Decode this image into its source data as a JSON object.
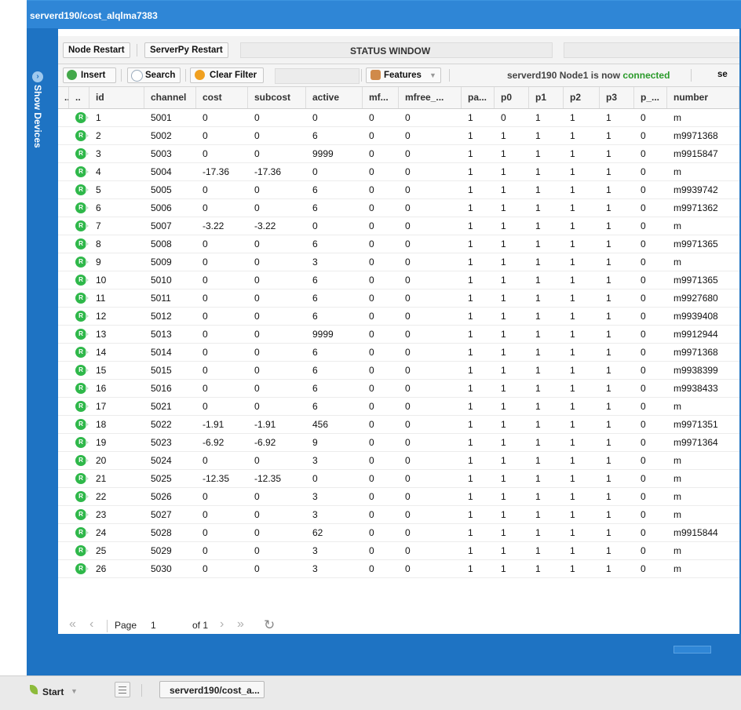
{
  "window": {
    "title": "serverd190/cost_alqlma7383"
  },
  "sidebar": {
    "label": "Show Devices"
  },
  "toolbar1": {
    "node_restart": "Node Restart",
    "serverpy_restart": "ServerPy Restart",
    "status_title": "STATUS WINDOW"
  },
  "toolbar2": {
    "insert": "Insert",
    "search": "Search",
    "clear_filter": "Clear Filter",
    "features": "Features",
    "status_prefix": "serverd190 Node1 is now",
    "status_state": "connected",
    "status_trailing": "se"
  },
  "columns": [
    "..",
    "..",
    "id",
    "channel",
    "cost",
    "subcost",
    "active",
    "mf...",
    "mfree_...",
    "pa...",
    "p0",
    "p1",
    "p2",
    "p3",
    "p_...",
    "number"
  ],
  "rows": [
    [
      "1",
      "5001",
      "0",
      "0",
      "0",
      "0",
      "0",
      "1",
      "0",
      "1",
      "1",
      "1",
      "0",
      "m"
    ],
    [
      "2",
      "5002",
      "0",
      "0",
      "6",
      "0",
      "0",
      "1",
      "1",
      "1",
      "1",
      "1",
      "0",
      "m9971368"
    ],
    [
      "3",
      "5003",
      "0",
      "0",
      "9999",
      "0",
      "0",
      "1",
      "1",
      "1",
      "1",
      "1",
      "0",
      "m9915847"
    ],
    [
      "4",
      "5004",
      "-17.36",
      "-17.36",
      "0",
      "0",
      "0",
      "1",
      "1",
      "1",
      "1",
      "1",
      "0",
      "m"
    ],
    [
      "5",
      "5005",
      "0",
      "0",
      "6",
      "0",
      "0",
      "1",
      "1",
      "1",
      "1",
      "1",
      "0",
      "m9939742"
    ],
    [
      "6",
      "5006",
      "0",
      "0",
      "6",
      "0",
      "0",
      "1",
      "1",
      "1",
      "1",
      "1",
      "0",
      "m9971362"
    ],
    [
      "7",
      "5007",
      "-3.22",
      "-3.22",
      "0",
      "0",
      "0",
      "1",
      "1",
      "1",
      "1",
      "1",
      "0",
      "m"
    ],
    [
      "8",
      "5008",
      "0",
      "0",
      "6",
      "0",
      "0",
      "1",
      "1",
      "1",
      "1",
      "1",
      "0",
      "m9971365"
    ],
    [
      "9",
      "5009",
      "0",
      "0",
      "3",
      "0",
      "0",
      "1",
      "1",
      "1",
      "1",
      "1",
      "0",
      "m"
    ],
    [
      "10",
      "5010",
      "0",
      "0",
      "6",
      "0",
      "0",
      "1",
      "1",
      "1",
      "1",
      "1",
      "0",
      "m9971365"
    ],
    [
      "11",
      "5011",
      "0",
      "0",
      "6",
      "0",
      "0",
      "1",
      "1",
      "1",
      "1",
      "1",
      "0",
      "m9927680"
    ],
    [
      "12",
      "5012",
      "0",
      "0",
      "6",
      "0",
      "0",
      "1",
      "1",
      "1",
      "1",
      "1",
      "0",
      "m9939408"
    ],
    [
      "13",
      "5013",
      "0",
      "0",
      "9999",
      "0",
      "0",
      "1",
      "1",
      "1",
      "1",
      "1",
      "0",
      "m9912944"
    ],
    [
      "14",
      "5014",
      "0",
      "0",
      "6",
      "0",
      "0",
      "1",
      "1",
      "1",
      "1",
      "1",
      "0",
      "m9971368"
    ],
    [
      "15",
      "5015",
      "0",
      "0",
      "6",
      "0",
      "0",
      "1",
      "1",
      "1",
      "1",
      "1",
      "0",
      "m9938399"
    ],
    [
      "16",
      "5016",
      "0",
      "0",
      "6",
      "0",
      "0",
      "1",
      "1",
      "1",
      "1",
      "1",
      "0",
      "m9938433"
    ],
    [
      "17",
      "5021",
      "0",
      "0",
      "6",
      "0",
      "0",
      "1",
      "1",
      "1",
      "1",
      "1",
      "0",
      "m"
    ],
    [
      "18",
      "5022",
      "-1.91",
      "-1.91",
      "456",
      "0",
      "0",
      "1",
      "1",
      "1",
      "1",
      "1",
      "0",
      "m9971351"
    ],
    [
      "19",
      "5023",
      "-6.92",
      "-6.92",
      "9",
      "0",
      "0",
      "1",
      "1",
      "1",
      "1",
      "1",
      "0",
      "m9971364"
    ],
    [
      "20",
      "5024",
      "0",
      "0",
      "3",
      "0",
      "0",
      "1",
      "1",
      "1",
      "1",
      "1",
      "0",
      "m"
    ],
    [
      "21",
      "5025",
      "-12.35",
      "-12.35",
      "0",
      "0",
      "0",
      "1",
      "1",
      "1",
      "1",
      "1",
      "0",
      "m"
    ],
    [
      "22",
      "5026",
      "0",
      "0",
      "3",
      "0",
      "0",
      "1",
      "1",
      "1",
      "1",
      "1",
      "0",
      "m"
    ],
    [
      "23",
      "5027",
      "0",
      "0",
      "3",
      "0",
      "0",
      "1",
      "1",
      "1",
      "1",
      "1",
      "0",
      "m"
    ],
    [
      "24",
      "5028",
      "0",
      "0",
      "62",
      "0",
      "0",
      "1",
      "1",
      "1",
      "1",
      "1",
      "0",
      "m9915844"
    ],
    [
      "25",
      "5029",
      "0",
      "0",
      "3",
      "0",
      "0",
      "1",
      "1",
      "1",
      "1",
      "1",
      "0",
      "m"
    ],
    [
      "26",
      "5030",
      "0",
      "0",
      "3",
      "0",
      "0",
      "1",
      "1",
      "1",
      "1",
      "1",
      "0",
      "m"
    ]
  ],
  "row_badge": "R",
  "pager": {
    "page_label": "Page",
    "page_value": "1",
    "of_label": "of 1"
  },
  "taskbar": {
    "start": "Start",
    "task": "serverd190/cost_a..."
  },
  "colors": {
    "title_bar": "#2f86d6",
    "accent_blue": "#1e73c3",
    "status_ok": "#2a9a2a",
    "badge_green": "#2fb84a"
  }
}
